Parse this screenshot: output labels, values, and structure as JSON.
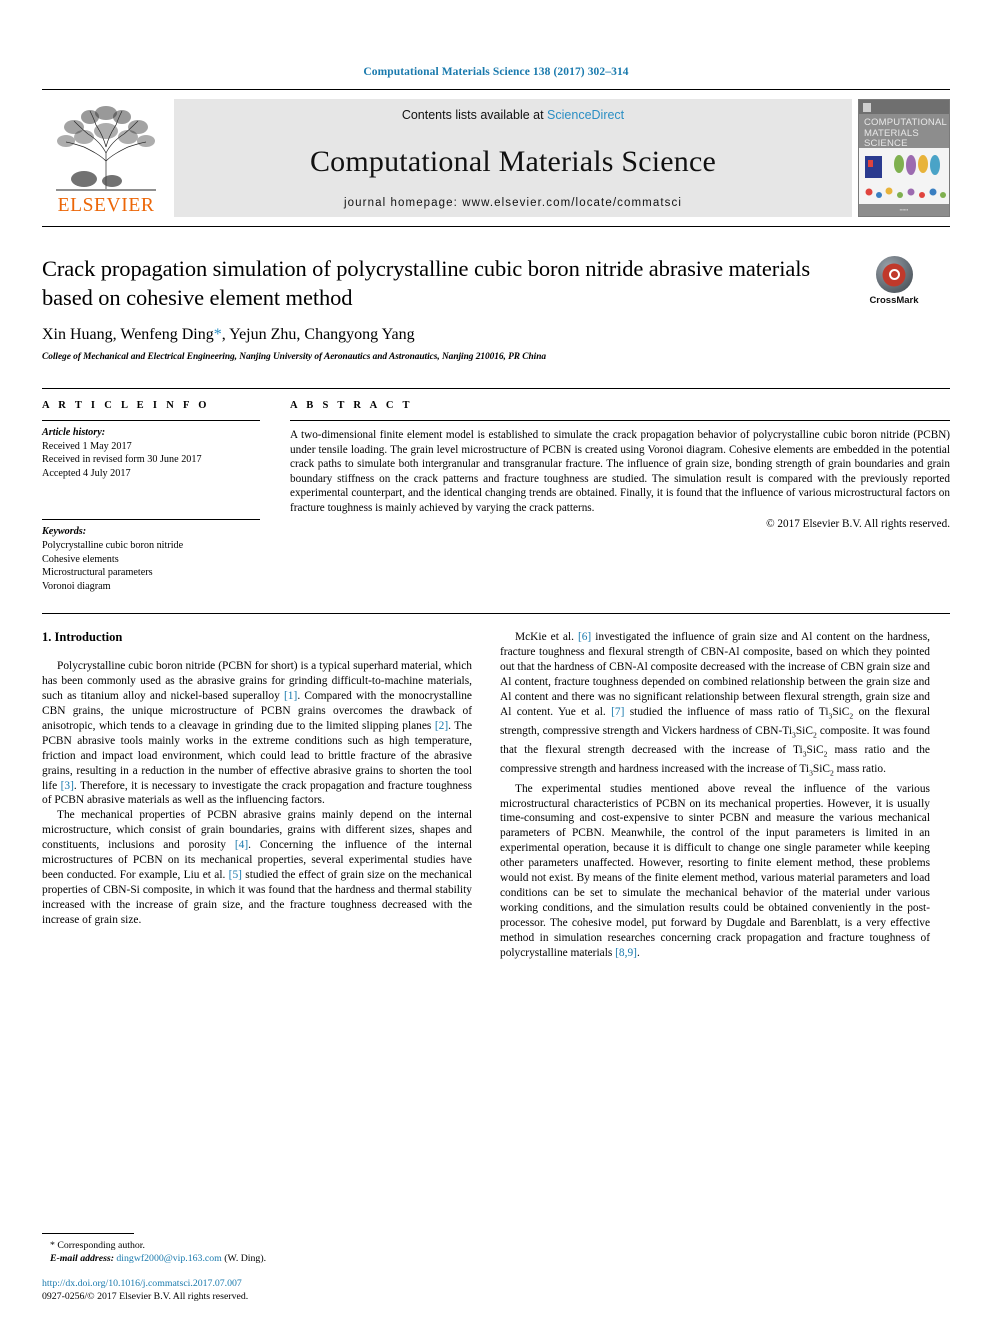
{
  "running_head": "Computational Materials Science 138 (2017) 302–314",
  "masthead": {
    "contents_prefix": "Contents lists available at ",
    "sciencedirect": "ScienceDirect",
    "journal_name": "Computational Materials Science",
    "homepage": "journal homepage: www.elsevier.com/locate/commatsci",
    "publisher": "ELSEVIER",
    "cover_title": "COMPUTATIONAL MATERIALS SCIENCE"
  },
  "title_block": {
    "title": "Crack propagation simulation of polycrystalline cubic boron nitride abrasive materials based on cohesive element method",
    "authors_pre": "Xin Huang, Wenfeng Ding",
    "corresponding_mark": "*",
    "authors_post": ", Yejun Zhu, Changyong Yang",
    "affiliation": "College of Mechanical and Electrical Engineering, Nanjing University of Aeronautics and Astronautics, Nanjing 210016, PR China",
    "crossmark_label": "CrossMark"
  },
  "article_info": {
    "heading": "A R T I C L E  I N F O",
    "history_label": "Article history:",
    "history": [
      "Received 1 May 2017",
      "Received in revised form 30 June 2017",
      "Accepted 4 July 2017"
    ],
    "keywords_label": "Keywords:",
    "keywords": [
      "Polycrystalline cubic boron nitride",
      "Cohesive elements",
      "Microstructural parameters",
      "Voronoi diagram"
    ]
  },
  "abstract": {
    "heading": "A B S T R A C T",
    "text": "A two-dimensional finite element model is established to simulate the crack propagation behavior of polycrystalline cubic boron nitride (PCBN) under tensile loading. The grain level microstructure of PCBN is created using Voronoi diagram. Cohesive elements are embedded in the potential crack paths to simulate both intergranular and transgranular fracture. The influence of grain size, bonding strength of grain boundaries and grain boundary stiffness on the crack patterns and fracture toughness are studied. The simulation result is compared with the previously reported experimental counterpart, and the identical changing trends are obtained. Finally, it is found that the influence of various microstructural factors on fracture toughness is mainly achieved by varying the crack patterns.",
    "copyright": "© 2017 Elsevier B.V. All rights reserved."
  },
  "body": {
    "section_title": "1. Introduction",
    "left_paragraphs": [
      "Polycrystalline cubic boron nitride (PCBN for short) is a typical superhard material, which has been commonly used as the abrasive grains for grinding difficult-to-machine materials, such as titanium alloy and nickel-based superalloy [1]. Compared with the monocrystalline CBN grains, the unique microstructure of PCBN grains overcomes the drawback of anisotropic, which tends to a cleavage in grinding due to the limited slipping planes [2]. The PCBN abrasive tools mainly works in the extreme conditions such as high temperature, friction and impact load environment, which could lead to brittle fracture of the abrasive grains, resulting in a reduction in the number of effective abrasive grains to shorten the tool life [3]. Therefore, it is necessary to investigate the crack propagation and fracture toughness of PCBN abrasive materials as well as the influencing factors.",
      "The mechanical properties of PCBN abrasive grains mainly depend on the internal microstructure, which consist of grain boundaries, grains with different sizes, shapes and constituents, inclusions and porosity [4]. Concerning the influence of the internal microstructures of PCBN on its mechanical properties, several experimental studies have been conducted. For example, Liu et al. [5] studied the effect of grain size on the mechanical properties of CBN-Si composite, in which it was found that the hardness and thermal stability increased with the increase of grain size, and the fracture toughness decreased with the increase of grain size."
    ],
    "right_paragraphs": [
      "McKie et al. [6] investigated the influence of grain size and Al content on the hardness, fracture toughness and flexural strength of CBN-Al composite, based on which they pointed out that the hardness of CBN-Al composite decreased with the increase of CBN grain size and Al content, fracture toughness depended on combined relationship between the grain size and Al content and there was no significant relationship between flexural strength, grain size and Al content. Yue et al. [7] studied the influence of mass ratio of Ti3SiC2 on the flexural strength, compressive strength and Vickers hardness of CBN-Ti3SiC2 composite. It was found that the flexural strength decreased with the increase of Ti3SiC2 mass ratio and the compressive strength and hardness increased with the increase of Ti3SiC2 mass ratio.",
      "The experimental studies mentioned above reveal the influence of the various microstructural characteristics of PCBN on its mechanical properties. However, it is usually time-consuming and cost-expensive to sinter PCBN and measure the various mechanical parameters of PCBN. Meanwhile, the control of the input parameters is limited in an experimental operation, because it is difficult to change one single parameter while keeping other parameters unaffected. However, resorting to finite element method, these problems would not exist. By means of the finite element method, various material parameters and load conditions can be set to simulate the mechanical behavior of the material under various working conditions, and the simulation results could be obtained conveniently in the post-processor. The cohesive model, put forward by Dugdale and Barenblatt, is a very effective method in simulation researches concerning crack propagation and fracture toughness of polycrystalline materials [8,9]."
    ]
  },
  "footnotes": {
    "corresponding": "* Corresponding author.",
    "email_label": "E-mail address:",
    "email": "dingwf2000@vip.163.com",
    "email_suffix": "(W. Ding).",
    "doi": "http://dx.doi.org/10.1016/j.commatsci.2017.07.007",
    "issn_line": "0927-0256/© 2017 Elsevier B.V. All rights reserved."
  },
  "colors": {
    "link_blue": "#1a7aad",
    "elsevier_orange": "#ec6607",
    "crossmark_red": "#c0392b"
  }
}
